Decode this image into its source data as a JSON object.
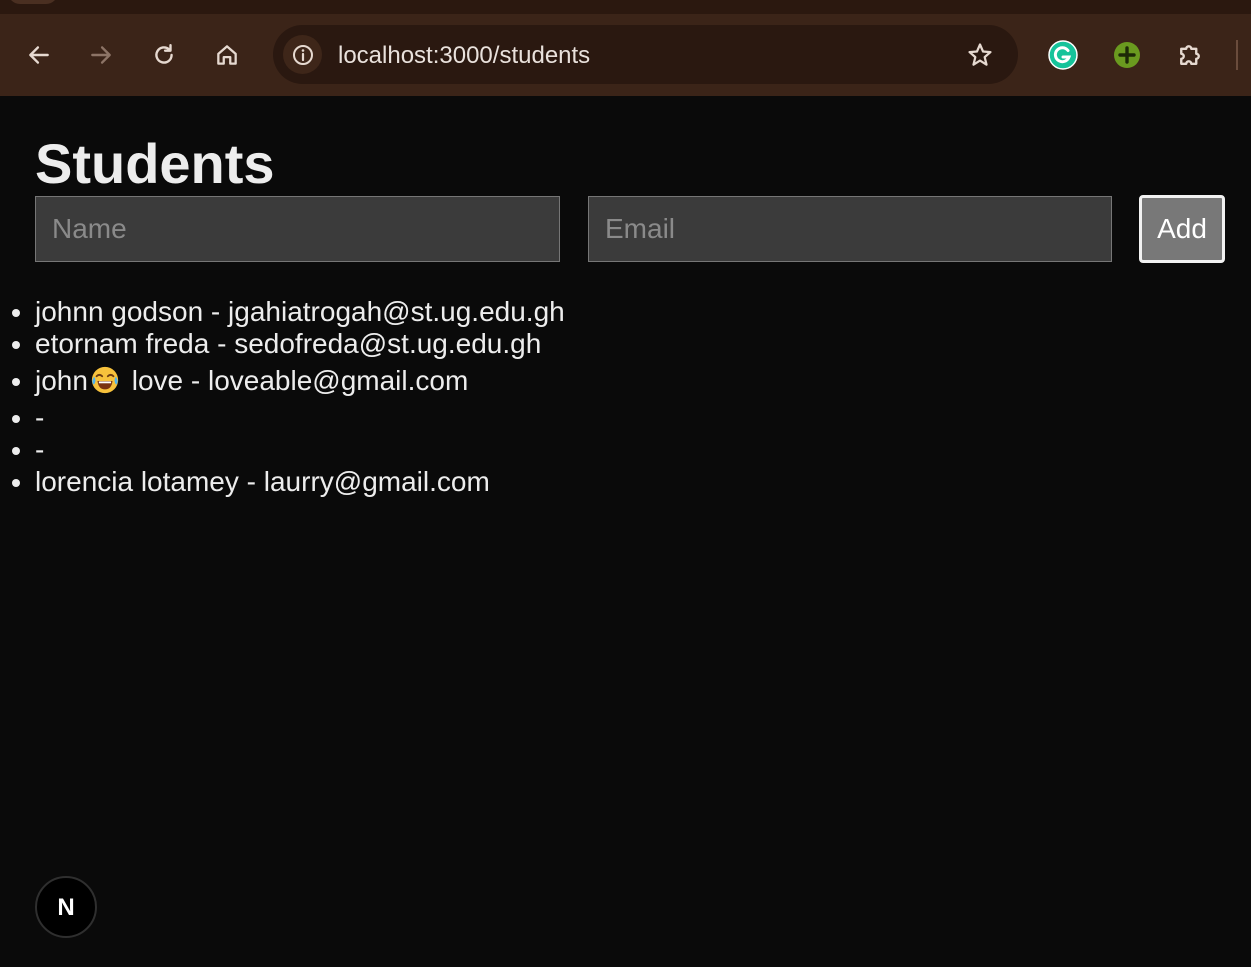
{
  "browser": {
    "url": "localhost:3000/students",
    "icons": {
      "back": "arrow-left-icon",
      "forward": "arrow-right-icon",
      "reload": "reload-icon",
      "home": "home-icon",
      "site_info": "info-icon",
      "bookmark": "star-icon",
      "grammarly": "grammarly-icon",
      "extension_green": "green-plus-extension-icon",
      "extensions": "puzzle-piece-icon"
    },
    "colors": {
      "toolbar": "#3b2418",
      "omnibox": "#2a1810"
    }
  },
  "page": {
    "title": "Students",
    "form": {
      "name_placeholder": "Name",
      "email_placeholder": "Email",
      "add_label": "Add"
    },
    "students": [
      {
        "name": "johnn godson",
        "separator": " - ",
        "email": "jgahiatrogah@st.ug.edu.gh"
      },
      {
        "name": "etornam freda",
        "separator": " - ",
        "email": "sedofreda@st.ug.edu.gh"
      },
      {
        "name_before": "john",
        "emoji": "face-with-tears-of-joy-emoji",
        "name_after": " love",
        "separator": " - ",
        "email": "loveable@gmail.com"
      },
      {
        "name": "",
        "separator": "-",
        "email": ""
      },
      {
        "name": "",
        "separator": "-",
        "email": ""
      },
      {
        "name": "lorencia lotamey",
        "separator": " - ",
        "email": "laurry@gmail.com"
      }
    ],
    "dev_badge_letter": "N",
    "colors": {
      "background": "#0a0a0a",
      "text": "#ededed",
      "input_bg": "#3b3b3b",
      "button_bg": "#787878"
    }
  }
}
